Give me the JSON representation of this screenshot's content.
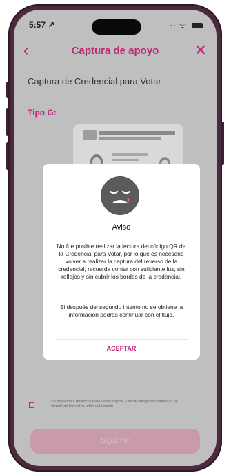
{
  "status_bar": {
    "time": "5:57 ↗",
    "signal": "·· ᯤ"
  },
  "nav": {
    "back_label": "‹",
    "title": "Captura de apoyo",
    "close_label": "✕"
  },
  "page": {
    "section_title": "Captura de Credencial para Votar",
    "tipo_label": "Tipo G:"
  },
  "modal": {
    "title": "Aviso",
    "paragraph1": "No fue posible realizar la lectura del código QR de la Credencial para Votar, por lo que es necesario volver a realizar la captura del reverso de la credencial; recuerda contar con suficiente luz, sin reflejos y sin cubrir los bordes de la credencial.",
    "paragraph2": "Si después del segundo intento no se obtiene la información podrás continuar con el flujo.",
    "accept_label": "ACEPTAR"
  },
  "consent": {
    "text": "Se presenta Credencial para Votar original y en las imágenes captadas se visualizan los datos adecuadamente."
  },
  "footer": {
    "submit_label": "Siguiente"
  },
  "colors": {
    "accent": "#c0267a",
    "overlay": "#bfbfbf"
  }
}
